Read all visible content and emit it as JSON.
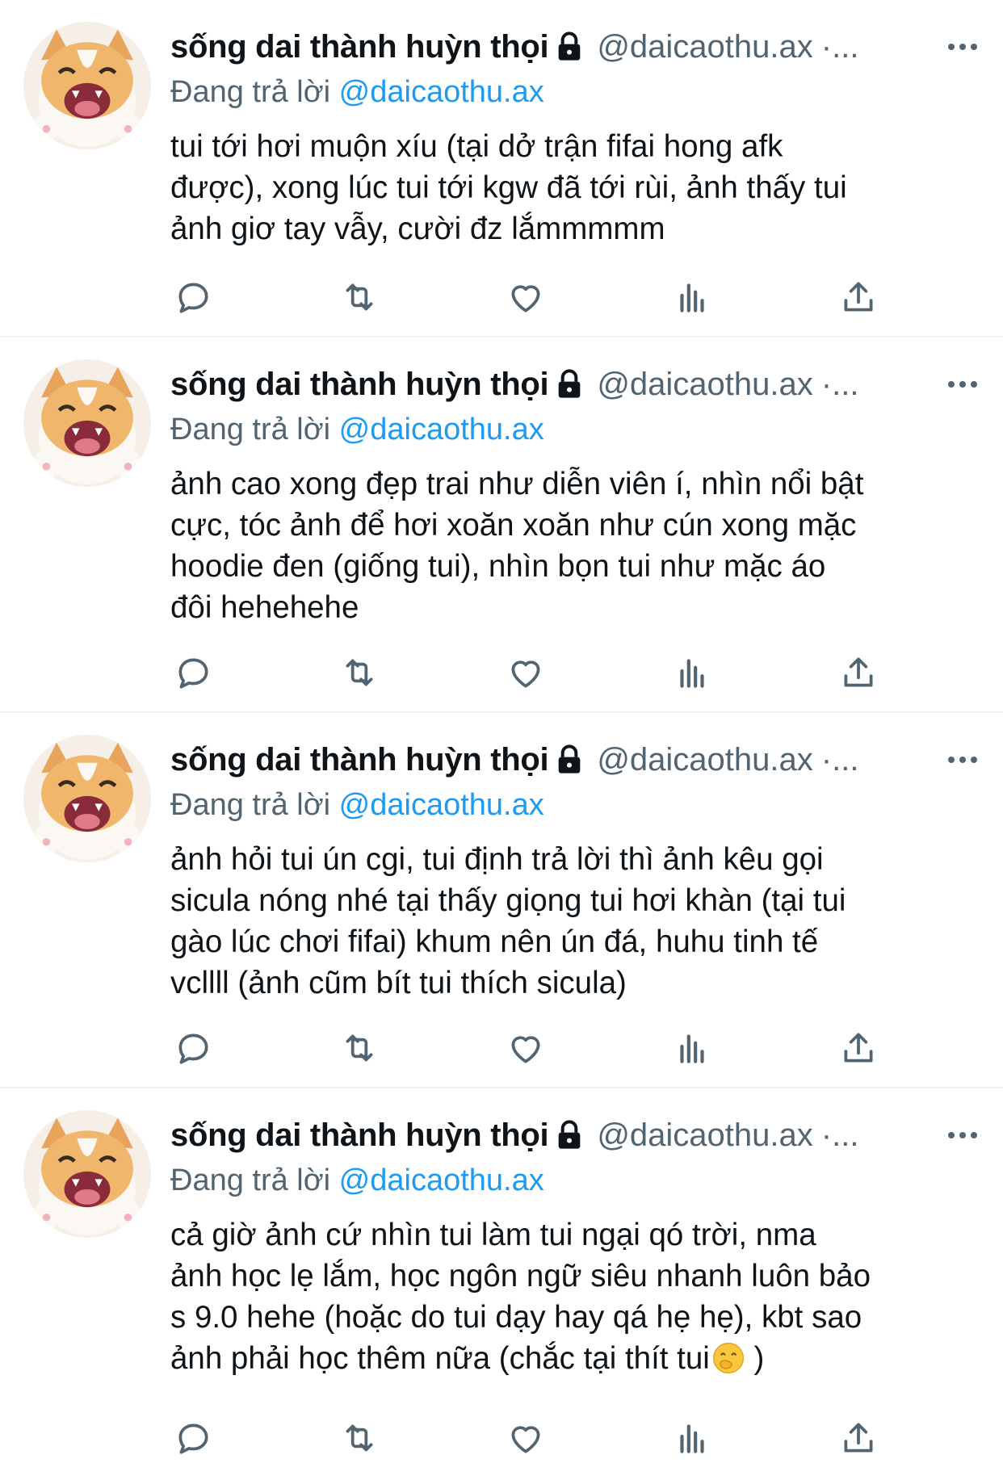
{
  "tweets": [
    {
      "display_name": "sống dai thành huỳn thọi",
      "handle": "@daicaothu.ax",
      "separator": "·...",
      "reply_prefix": "Đang trả lời",
      "reply_handle": "@daicaothu.ax",
      "text": "tui tới hơi muộn xíu (tại dở trận fifai hong afk\nđược), xong lúc tui tới kgw đã tới rùi, ảnh thấy tui\nảnh giơ tay vẫy, cười đz lắmmmmm"
    },
    {
      "display_name": "sống dai thành huỳn thọi",
      "handle": "@daicaothu.ax",
      "separator": "·...",
      "reply_prefix": "Đang trả lời",
      "reply_handle": "@daicaothu.ax",
      "text": "ảnh cao xong đẹp trai như diễn viên í, nhìn nổi bật\ncực, tóc ảnh để hơi xoăn xoăn như cún xong mặc\nhoodie đen (giống tui), nhìn bọn tui như mặc áo\nđôi hehehehe"
    },
    {
      "display_name": "sống dai thành huỳn thọi",
      "handle": "@daicaothu.ax",
      "separator": "·...",
      "reply_prefix": "Đang trả lời",
      "reply_handle": "@daicaothu.ax",
      "text": "ảnh hỏi tui ún cgi, tui định trả lời thì ảnh kêu gọi\nsicula nóng nhé tại thấy giọng tui hơi khàn (tại tui\ngào lúc chơi fifai) khum nên ún đá, huhu tinh tế\nvcllll (ảnh cũm bít tui thích sicula)"
    },
    {
      "display_name": "sống dai thành huỳn thọi",
      "handle": "@daicaothu.ax",
      "separator": "·...",
      "reply_prefix": "Đang trả lời",
      "reply_handle": "@daicaothu.ax",
      "text": "cả giờ ảnh cứ nhìn tui làm tui ngại qó trời, nma\nảnh học lẹ lắm, học ngôn ngữ siêu nhanh luôn bảo\ns 9.0 hehe (hoặc do tui dạy hay qá hẹ hẹ), kbt sao\nảnh phải học thêm nữa (chắc tại thít tui",
      "text_suffix": " )"
    }
  ],
  "icons": {
    "reply": "comment-bubble-icon",
    "retweet": "retweet-icon",
    "like": "heart-icon",
    "views": "bar-chart-icon",
    "share": "share-upload-icon",
    "more": "more-dots-icon",
    "lock": "lock-icon",
    "emoji": "hand-over-mouth-emoji"
  },
  "colors": {
    "text": "#0f1419",
    "secondary": "#536471",
    "link": "#1d9bf0",
    "divider": "#eff3f4"
  }
}
